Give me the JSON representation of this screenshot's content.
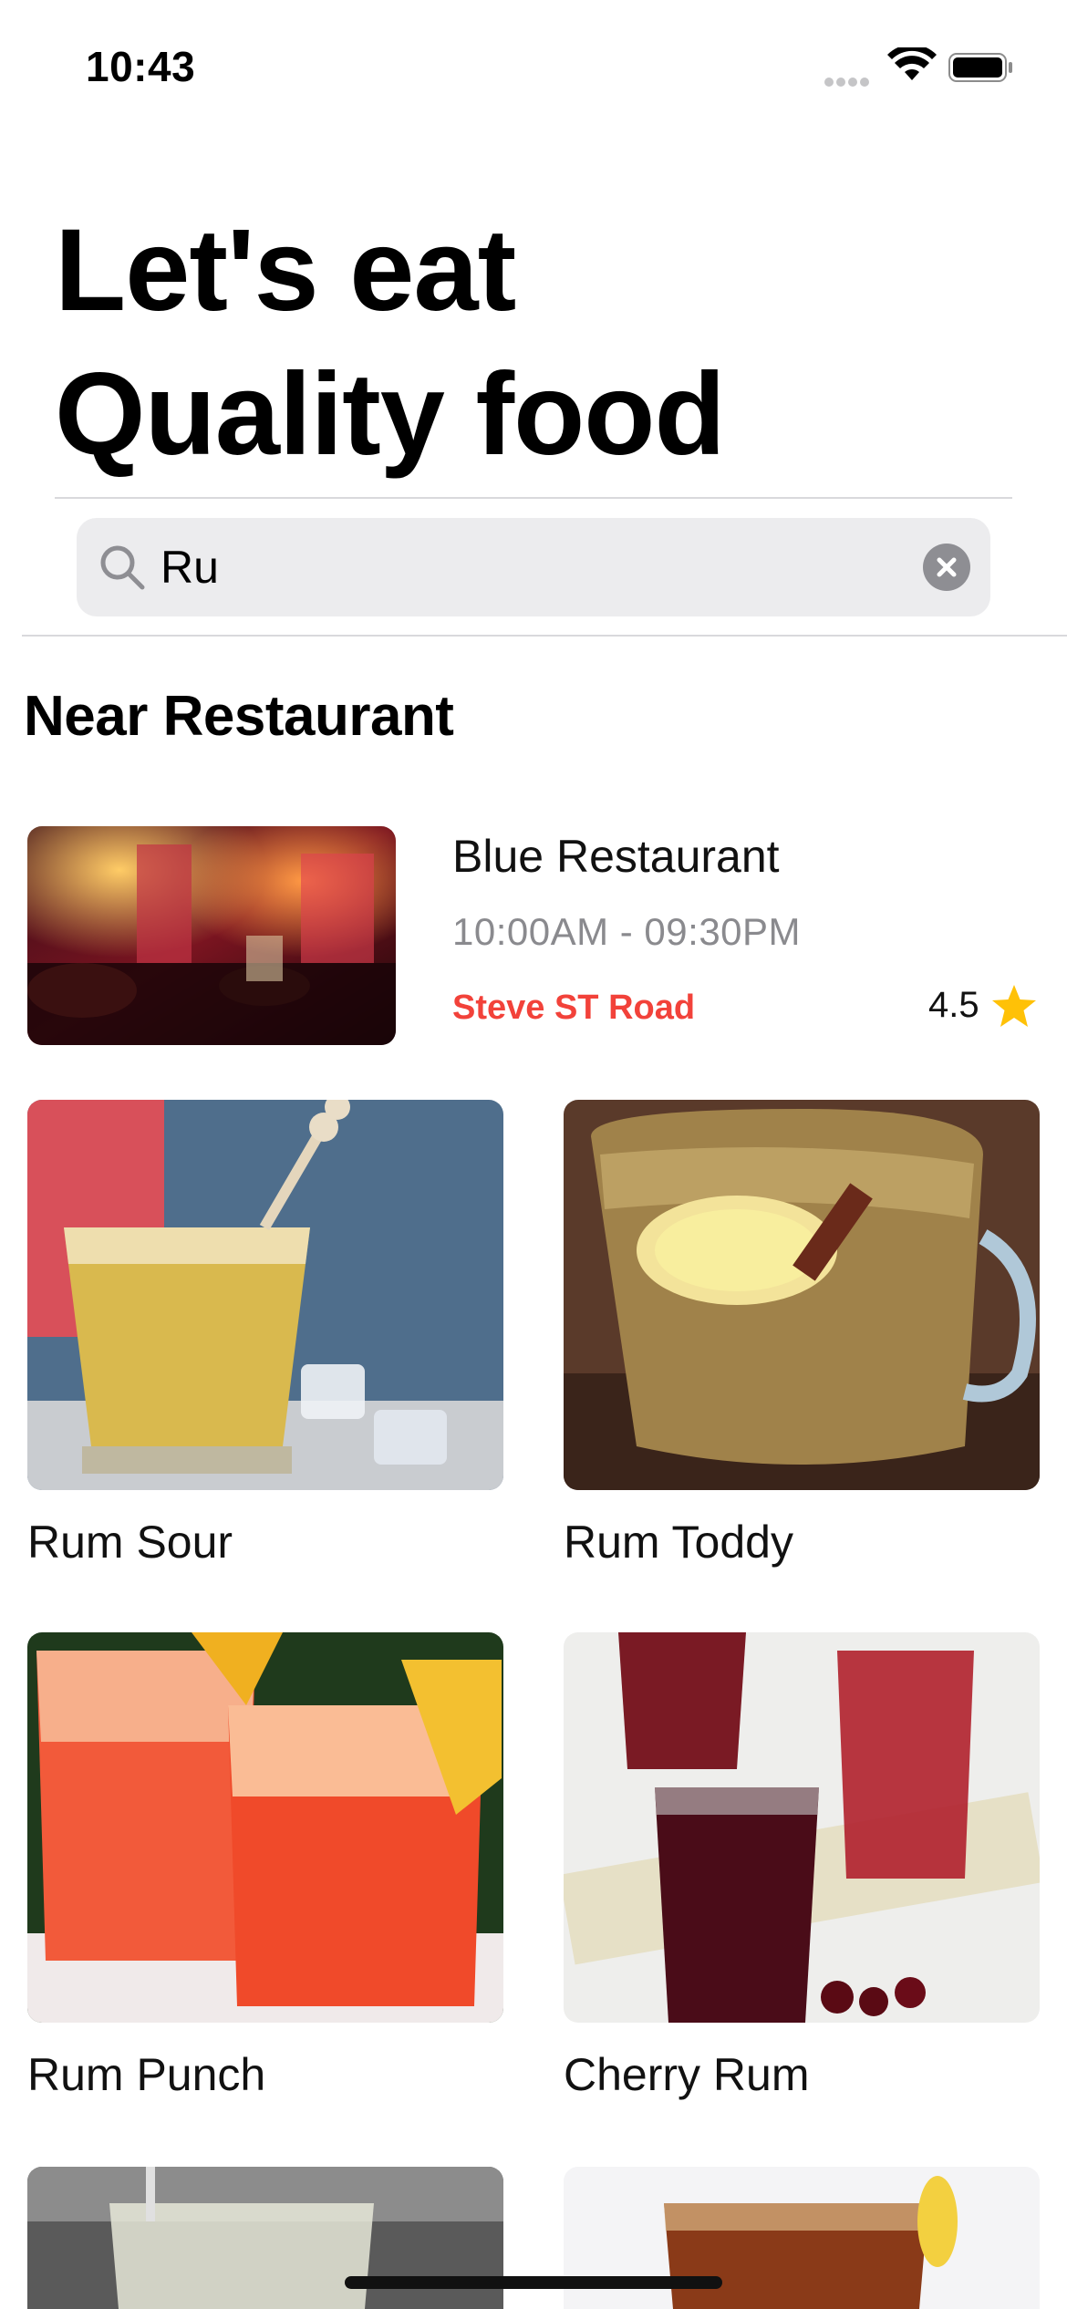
{
  "status_bar": {
    "time": "10:43"
  },
  "header": {
    "line1": "Let's eat",
    "line2": "Quality food"
  },
  "search": {
    "value": "Ru"
  },
  "section": {
    "title": "Near Restaurant"
  },
  "restaurant": {
    "name": "Blue Restaurant",
    "hours": "10:00AM - 09:30PM",
    "address": "Steve ST Road",
    "rating": "4.5"
  },
  "items": [
    {
      "label": "Rum Sour"
    },
    {
      "label": "Rum Toddy"
    },
    {
      "label": "Rum Punch"
    },
    {
      "label": "Cherry Rum"
    }
  ],
  "colors": {
    "accent_red": "#f2423a",
    "star": "#ffc107",
    "search_bg": "#ececee",
    "muted_text": "#8a8a8e"
  },
  "icons": {
    "search": "magnifying-glass",
    "clear": "x-circle",
    "rating": "star"
  }
}
